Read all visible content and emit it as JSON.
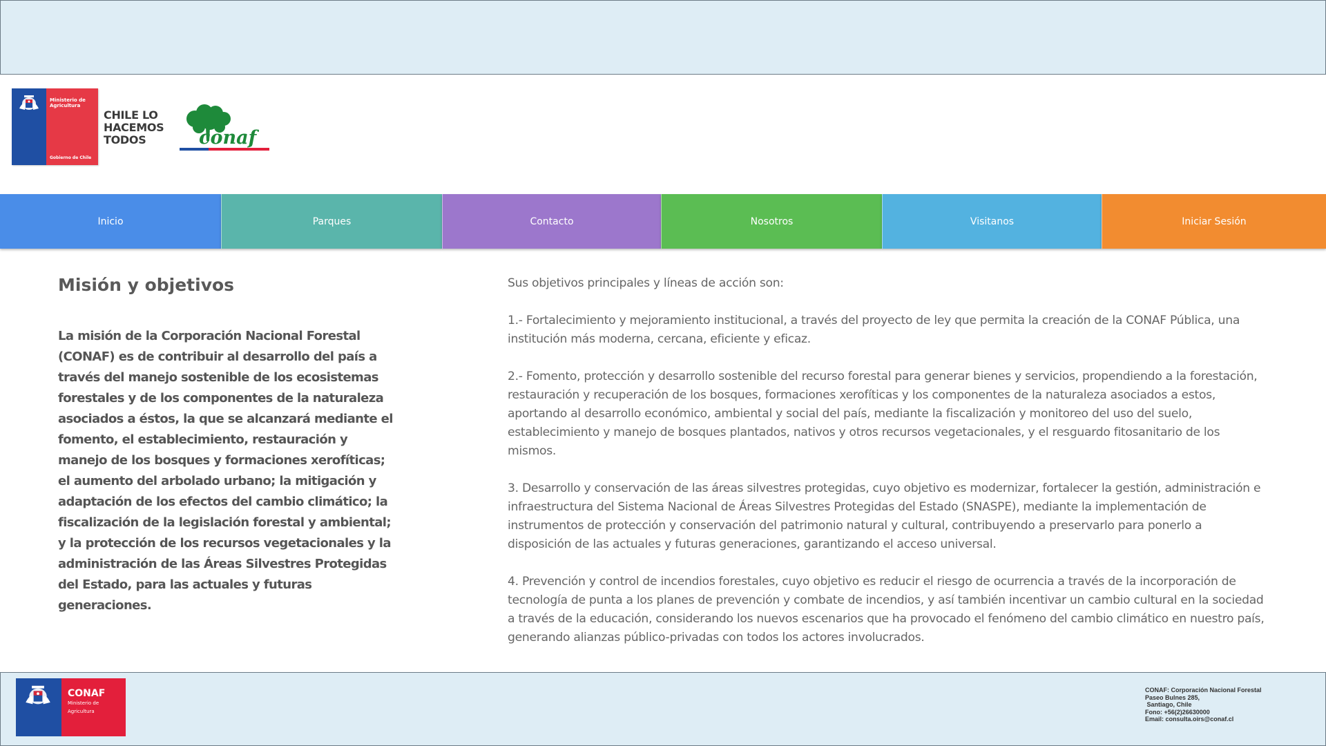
{
  "header": {
    "gov_logo": {
      "ministry": "Ministerio de Agricultura",
      "government": "Gobierno de Chile"
    },
    "slogan": [
      "CHILE LO",
      "HACEMOS",
      "TODOS"
    ],
    "brand_logo": "conaf"
  },
  "nav": {
    "items": [
      {
        "label": "Inicio",
        "color": "#4a8de8"
      },
      {
        "label": "Parques",
        "color": "#5ab5ab"
      },
      {
        "label": "Contacto",
        "color": "#9c77cc"
      },
      {
        "label": "Nosotros",
        "color": "#5bbd53"
      },
      {
        "label": "Visitanos",
        "color": "#53b2e0"
      },
      {
        "label": "Iniciar Sesión",
        "color": "#f28c30"
      }
    ]
  },
  "main": {
    "title": "Misión y objetivos",
    "mission": "La misión de la Corporación Nacional Forestal (CONAF) es de contribuir al desarrollo del país a través del manejo sostenible de los ecosistemas forestales y de los componentes de la naturaleza asociados a éstos, la que se alcanzará mediante el fomento, el establecimiento, restauración y manejo de los bosques y formaciones xerofíticas; el aumento del arbolado urbano; la mitigación y adaptación de los efectos del cambio climático; la fiscalización de la legislación forestal y ambiental; y la protección de los recursos vegetacionales y la administración de las Áreas Silvestres Protegidas del Estado, para las actuales y futuras generaciones.",
    "objectives_intro": "Sus objetivos principales y líneas de acción son:",
    "objectives": [
      "1.- Fortalecimiento y mejoramiento institucional, a través del proyecto de ley que permita la creación de la CONAF Pública, una institución más moderna, cercana, eficiente y eficaz.",
      "2.- Fomento, protección y desarrollo sostenible del recurso forestal para generar bienes y servicios, propendiendo a la forestación, restauración y recuperación de los bosques, formaciones xerofíticas y los componentes de la naturaleza asociados a estos, aportando al desarrollo económico, ambiental y social del país, mediante la fiscalización y  monitoreo del uso del suelo, establecimiento y manejo de bosques plantados, nativos y otros recursos vegetacionales, y el resguardo fitosanitario de los mismos.",
      "3. Desarrollo y conservación de las áreas silvestres protegidas, cuyo objetivo es modernizar, fortalecer la gestión, administración e infraestructura del Sistema Nacional de Áreas Silvestres Protegidas del Estado (SNASPE), mediante la implementación de instrumentos de protección y conservación del patrimonio natural y cultural, contribuyendo a preservarlo para ponerlo a disposición de las actuales y futuras generaciones, garantizando el acceso universal.",
      "4. Prevención y control de incendios forestales, cuyo objetivo es reducir el riesgo de ocurrencia a través de la incorporación de tecnología de punta a los planes de prevención y combate de incendios, y así también incentivar un cambio cultural en la sociedad a través de la  educación, considerando los nuevos escenarios que ha provocado el fenómeno del cambio climático en nuestro país, generando alianzas público-privadas con todos los actores involucrados."
    ]
  },
  "footer": {
    "logo": {
      "brand": "CONAF",
      "ministry": "Ministerio de Agricultura"
    },
    "contact": [
      "CONAF: Corporación Nacional Forestal",
      "Paseo Bulnes 285,",
      " Santiago, Chile",
      "Fono: +56(2)26630000",
      "Email: consulta.oirs@conaf.cl"
    ]
  }
}
